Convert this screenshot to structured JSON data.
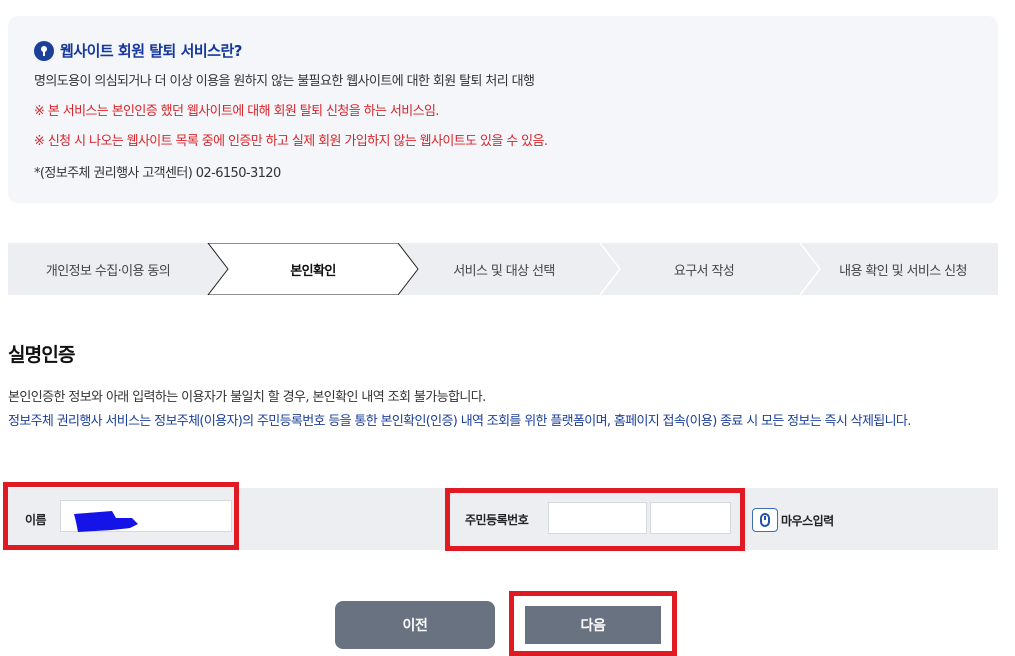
{
  "info": {
    "title": "웹사이트 회원 탈퇴 서비스란?",
    "line1": "명의도용이 의심되거나 더 이상 이용을 원하지 않는 불필요한 웹사이트에 대한 회원 탈퇴 처리 대행",
    "warning1": "※ 본 서비스는 본인인증 했던 웹사이트에 대해 회원 탈퇴 신청을 하는 서비스임.",
    "warning2": "※ 신청 시 나오는 웹사이트 목록 중에 인증만 하고 실제 회원 가입하지 않는 웹사이트도 있을 수 있음.",
    "contact": "*(정보주체 권리행사 고객센터) 02-6150-3120"
  },
  "steps": [
    {
      "label": "개인정보 수집·이용 동의",
      "active": false
    },
    {
      "label": "본인확인",
      "active": true
    },
    {
      "label": "서비스 및 대상 선택",
      "active": false
    },
    {
      "label": "요구서 작성",
      "active": false
    },
    {
      "label": "내용 확인 및 서비스 신청",
      "active": false
    }
  ],
  "section": {
    "title": "실명인증",
    "desc1": "본인인증한 정보와 아래 입력하는 이용자가 불일치 할 경우, 본인확인 내역 조회 불가능합니다.",
    "desc2": "정보주체 권리행사 서비스는 정보주체(이용자)의 주민등록번호 등을 통한 본인확인(인증) 내역 조회를 위한 플랫폼이며, 홈페이지 접속(이용) 종료 시 모든 정보는 즉시 삭제됩니다."
  },
  "form": {
    "name_label": "이름",
    "name_value": "",
    "rrn_label": "주민등록번호",
    "rrn_front": "",
    "rrn_back": "",
    "mouse_input_label": "마우스입력"
  },
  "buttons": {
    "prev": "이전",
    "next": "다음"
  },
  "colors": {
    "accent": "#1c3f99",
    "warning": "#d8262b",
    "highlight": "#e01a22",
    "button": "#697280"
  }
}
